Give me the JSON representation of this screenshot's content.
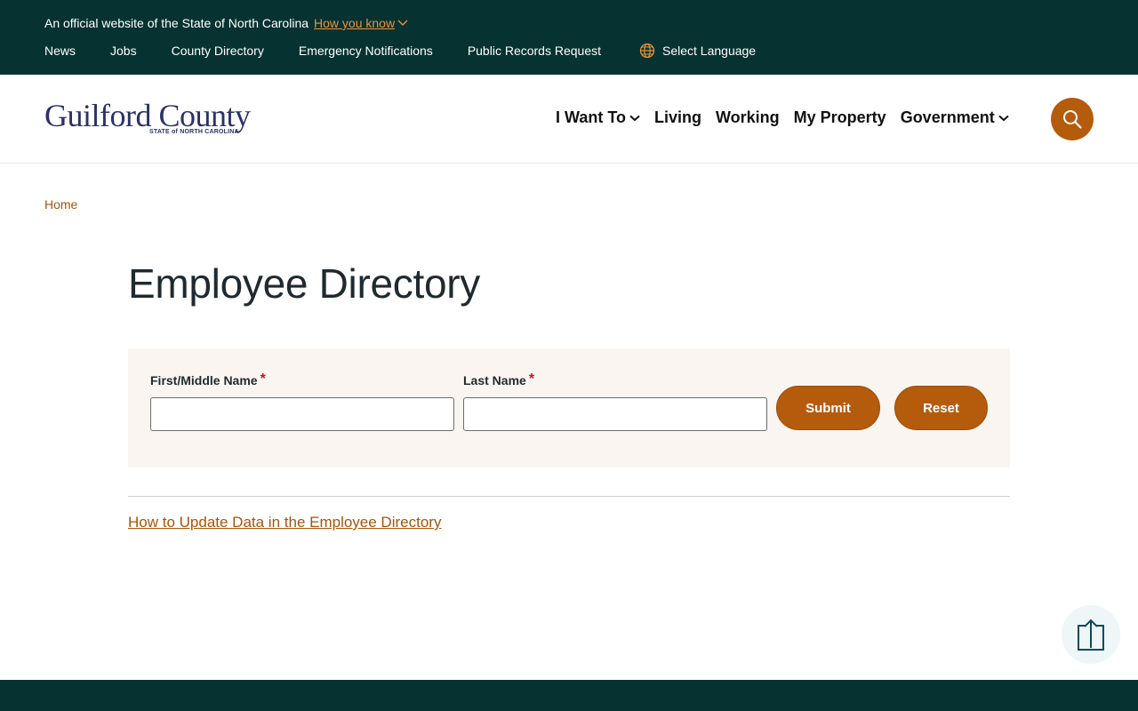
{
  "topbar": {
    "official_text": "An official website of the State of North Carolina",
    "how_you_know": "How you know",
    "links": [
      "News",
      "Jobs",
      "County Directory",
      "Emergency Notifications",
      "Public Records Request"
    ],
    "language": "Select Language"
  },
  "header": {
    "logo_text": "Guilford County",
    "logo_sub": "STATE of NORTH CAROLINA",
    "nav": [
      "I Want To",
      "Living",
      "Working",
      "My Property",
      "Government"
    ]
  },
  "breadcrumb": {
    "home": "Home"
  },
  "page": {
    "title": "Employee Directory"
  },
  "form": {
    "first_label": "First/Middle Name",
    "last_label": "Last Name",
    "required_mark": "*",
    "first_value": "",
    "last_value": "",
    "submit": "Submit",
    "reset": "Reset"
  },
  "help_link": "How to Update Data in the Employee Directory",
  "colors": {
    "dark_teal": "#073232",
    "accent_orange": "#b55b0c",
    "link_orange": "#a6550b",
    "panel_bg": "#faf5f1"
  }
}
